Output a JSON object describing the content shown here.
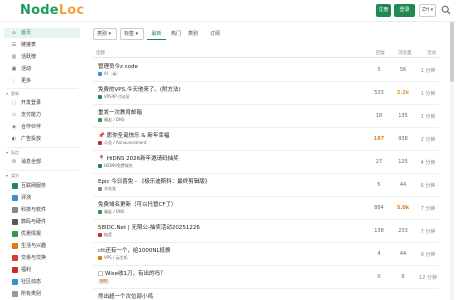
{
  "header": {
    "logo_part1": "Node",
    "logo_part2": "Loc",
    "signup_label": "注册",
    "login_label": "登录",
    "lang_label": "ZH"
  },
  "sidebar": {
    "top_items": [
      {
        "label": "首页",
        "icon": "home-icon"
      },
      {
        "label": "链接表",
        "icon": "list-icon"
      },
      {
        "label": "活跃榜",
        "icon": "chart-icon"
      },
      {
        "label": "活动",
        "icon": "calendar-icon"
      },
      {
        "label": "更多",
        "icon": "more-icon"
      }
    ],
    "section1_title": "更新",
    "section1_items": [
      {
        "label": "开发登录"
      },
      {
        "label": "支付能力"
      },
      {
        "label": "合作伙伴"
      },
      {
        "label": "广告投放"
      }
    ],
    "section2_title": "私信",
    "section2_items": [
      {
        "label": "消息全部"
      }
    ],
    "section3_title": "类别",
    "categories": [
      {
        "label": "互联网服务",
        "color": "#1e8a52"
      },
      {
        "label": "评测",
        "color": "#3a8ed8"
      },
      {
        "label": "科技与软件",
        "color": "#888888"
      },
      {
        "label": "数码与硬件",
        "color": "#5a5a5a"
      },
      {
        "label": "优惠情报",
        "color": "#2e9a4a"
      },
      {
        "label": "生活与兴趣",
        "color": "#e07b0f"
      },
      {
        "label": "交易与交换",
        "color": "#d03c3c"
      },
      {
        "label": "福利",
        "color": "#c03030"
      },
      {
        "label": "社区动态",
        "color": "#3a8ed8"
      },
      {
        "label": "所有类别",
        "color": "#999999"
      }
    ]
  },
  "filters": {
    "category_dropdown": "类别",
    "tag_dropdown": "标签",
    "tabs": [
      "最新",
      "热门",
      "类别",
      "订阅"
    ]
  },
  "table": {
    "headers": {
      "topic": "话题",
      "replies": "回复",
      "views": "浏览量",
      "activity": "活动"
    },
    "rows": [
      {
        "title": "管理员今z code",
        "meta_cat": "AI",
        "cat_color": "#3a8ed8",
        "tag": "AI",
        "replies": "5",
        "views": "56",
        "activity": "1 分钟",
        "pinned": false
      },
      {
        "title": "免费的VPS,今天他来了。(附方法)",
        "meta_cat": "VPS/IP 讨论区",
        "cat_color": "#1e8a52",
        "tag": "",
        "replies": "533",
        "views": "2.2k",
        "activity": "1 分钟",
        "pinned": false
      },
      {
        "title": "重发一次教育邮箱",
        "meta_cat": "福友 / DNS",
        "cat_color": "#2e9a4a",
        "tag": "",
        "replies": "18",
        "views": "135",
        "activity": "1 分钟",
        "pinned": false
      },
      {
        "title": "📌 愿你圣诞快乐 & 新年幸福",
        "meta_cat": "公告 / Announcement",
        "cat_color": "#c03030",
        "tag": "",
        "replies": "187",
        "views": "938",
        "activity": "2 分钟",
        "pinned": true
      },
      {
        "title": "HiDNS 2026新年邀请码抽奖",
        "meta_cat": "HiDNS免费域名",
        "cat_color": "#1e8a52",
        "tag": "",
        "replies": "27",
        "views": "125",
        "activity": "4 分钟",
        "pinned": true
      },
      {
        "title": "Epic 今日喜免 - 《极乐迪斯科：最终剪辑版》",
        "meta_cat": "羊毛党",
        "cat_color": "#888888",
        "tag": "",
        "replies": "5",
        "views": "44",
        "activity": "6 分钟",
        "pinned": false
      },
      {
        "title": "免费域名更新（可以托管CF了）",
        "meta_cat": "福友 / DNS",
        "cat_color": "#2e9a4a",
        "tag": "",
        "replies": "884",
        "views": "5.0k",
        "activity": "7 分钟",
        "pinned": false
      },
      {
        "title": "58IDC.Net | 无限公-抽奖活动20251226",
        "meta_cat": "抽奖",
        "cat_color": "#c03030",
        "tag": "",
        "replies": "138",
        "views": "233",
        "activity": "7 分钟",
        "pinned": false
      },
      {
        "title": "ctt还有一个，给1000NL抵换",
        "meta_cat": "VPS / 云主机",
        "cat_color": "#e07b0f",
        "tag": "",
        "replies": "4",
        "views": "44",
        "activity": "9 分钟",
        "pinned": false
      },
      {
        "title": "□ Wise收1刀，有出的吗？",
        "meta_cat": "",
        "cat_color": "#999999",
        "tag": "求购",
        "replies": "0",
        "views": "6",
        "activity": "12 分钟",
        "pinned": false
      },
      {
        "title": "然出超一个次位部小鸡",
        "meta_cat": "",
        "cat_color": "#999999",
        "tag": "",
        "replies": "",
        "views": "",
        "activity": "",
        "pinned": false
      }
    ]
  }
}
